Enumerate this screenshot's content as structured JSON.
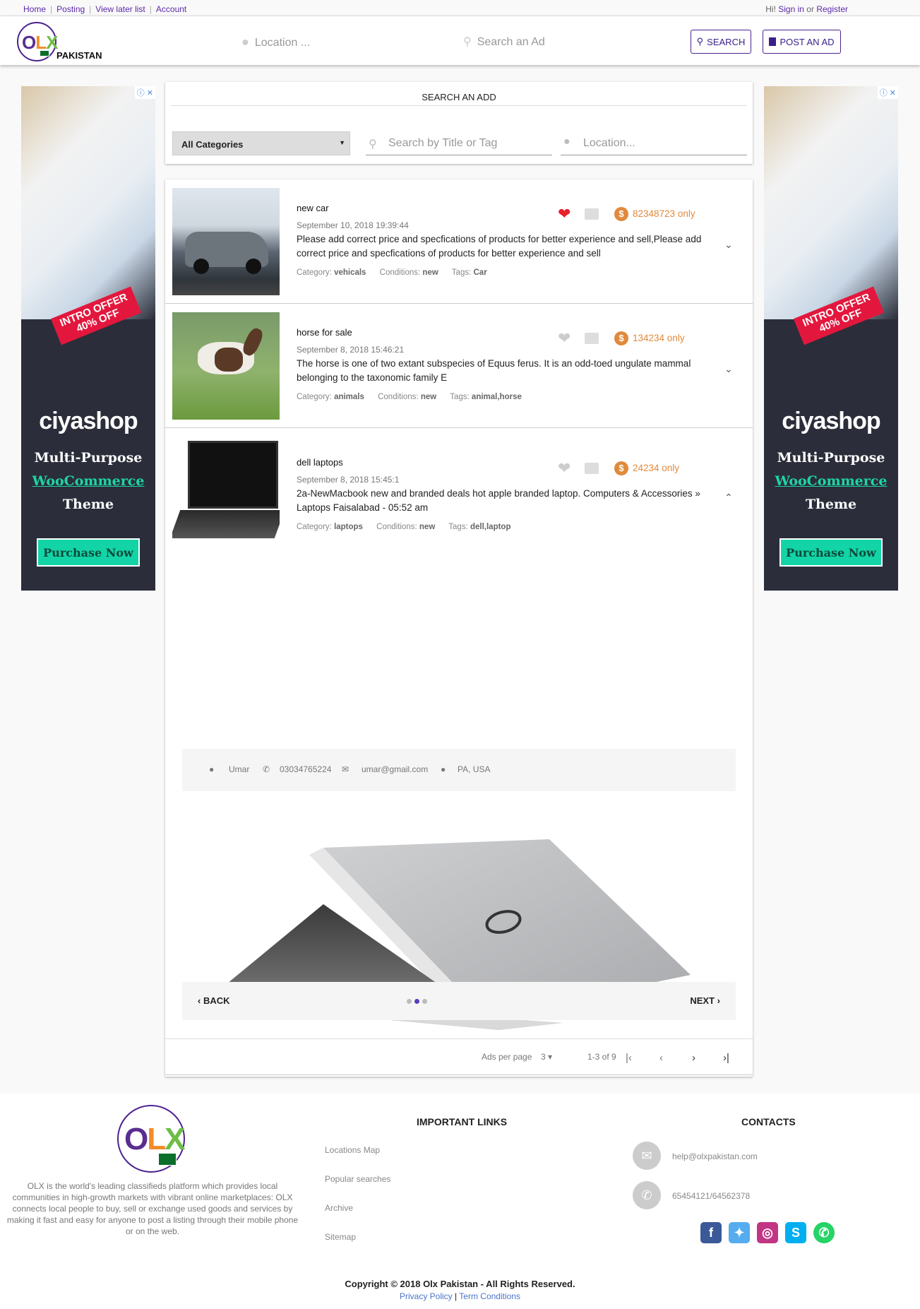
{
  "topbar": {
    "links": [
      "Home",
      "Posting",
      "View later list",
      "Account"
    ],
    "greeting": "Hi!",
    "signin": "Sign in",
    "or": "or",
    "register": "Register"
  },
  "header": {
    "logo_text": "OLX",
    "country": "PAKISTAN",
    "location_placeholder": "Location ...",
    "search_placeholder": "Search an Ad",
    "search_button": "SEARCH",
    "post_button": "POST AN AD"
  },
  "ad_banner": {
    "promo_line1": "INTRO OFFER",
    "promo_line2": "40% OFF",
    "brand": "ciyashop",
    "line1": "Multi-Purpose",
    "line2": "WooCommerce",
    "line3": "Theme",
    "cta": "Purchase Now"
  },
  "search_card": {
    "title": "SEARCH AN ADD",
    "category": "All Categories",
    "title_placeholder": "Search by Title or Tag",
    "location_placeholder": "Location..."
  },
  "listings": [
    {
      "title": "new car",
      "date": "September 10, 2018 19:39:44",
      "description": "Please add correct price and specfications of products for better experience and sell,Please add correct price and specfications of products for better experience and sell",
      "price": "82348723 only",
      "category_label": "Category:",
      "category": "vehicals",
      "conditions_label": "Conditions:",
      "condition": "new",
      "tags_label": "Tags:",
      "tags": "Car",
      "favorited": true
    },
    {
      "title": "horse for sale",
      "date": "September 8, 2018 15:46:21",
      "description": "The horse is one of two extant subspecies of Equus ferus. It is an odd-toed ungulate mammal belonging to the taxonomic family E",
      "price": "134234 only",
      "category_label": "Category:",
      "category": "animals",
      "conditions_label": "Conditions:",
      "condition": "new",
      "tags_label": "Tags:",
      "tags": "animal,horse",
      "favorited": false
    },
    {
      "title": "dell laptops",
      "date": "September 8, 2018 15:45:1",
      "description": "2a-NewMacbook new and branded deals hot apple branded laptop. Computers & Accessories » Laptops Faisalabad - 05:52 am",
      "price": "24234 only",
      "category_label": "Category:",
      "category": "laptops",
      "conditions_label": "Conditions:",
      "condition": "new",
      "tags_label": "Tags:",
      "tags": "dell,laptop",
      "favorited": false
    }
  ],
  "expanded": {
    "user": "Umar",
    "phone": "03034765224",
    "email": "umar@gmail.com",
    "location": "PA, USA",
    "back": "BACK",
    "next": "NEXT"
  },
  "pagination": {
    "ads_per_page_label": "Ads per page",
    "ads_per_page": "3",
    "range": "1-3 of 9"
  },
  "footer": {
    "description": "OLX is the world's leading classifieds platform which provides local communities in high-growth markets with vibrant online marketplaces: OLX connects local people to buy, sell or exchange used goods and services by making it fast and easy for anyone to post a listing through their mobile phone or on the web.",
    "links_title": "IMPORTANT LINKS",
    "links": [
      "Locations Map",
      "Popular searches",
      "Archive",
      "Sitemap"
    ],
    "contacts_title": "CONTACTS",
    "email": "help@olxpakistan.com",
    "phone": "65454121/64562378",
    "copyright": "Copyright © 2018 Olx Pakistan - All Rights Reserved.",
    "privacy": "Privacy Policy",
    "terms": "Term Conditions"
  },
  "colors": {
    "brand_purple": "#4c2390",
    "price_orange": "#e08a3c",
    "heart_red": "#e8202a"
  }
}
